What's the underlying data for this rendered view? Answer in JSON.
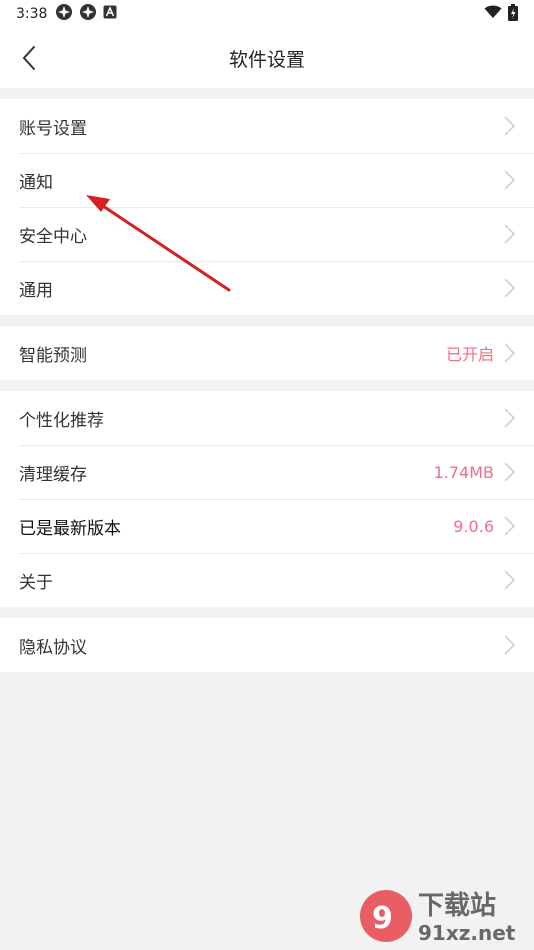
{
  "status_bar": {
    "time": "3:38",
    "icons": [
      "notification-icon",
      "notification-icon",
      "a-icon"
    ],
    "right_icons": [
      "wifi-icon",
      "battery-icon"
    ]
  },
  "header": {
    "title": "软件设置",
    "back_icon": "chevron-left-icon"
  },
  "groups": [
    {
      "items": [
        {
          "label": "账号设置"
        },
        {
          "label": "通知"
        },
        {
          "label": "安全中心"
        },
        {
          "label": "通用"
        }
      ]
    },
    {
      "items": [
        {
          "label": "智能预测",
          "value": "已开启"
        }
      ]
    },
    {
      "items": [
        {
          "label": "个性化推荐"
        },
        {
          "label": "清理缓存",
          "value": "1.74MB"
        },
        {
          "label": "已是最新版本",
          "value": "9.0.6"
        },
        {
          "label": "关于"
        }
      ]
    },
    {
      "items": [
        {
          "label": "隐私协议"
        }
      ]
    }
  ],
  "colors": {
    "accent_value": "#f06f84",
    "annotation_arrow": "#d42020",
    "background": "#f2f2f2"
  },
  "watermark": {
    "text": "下载站",
    "domain": "91xz.net"
  }
}
